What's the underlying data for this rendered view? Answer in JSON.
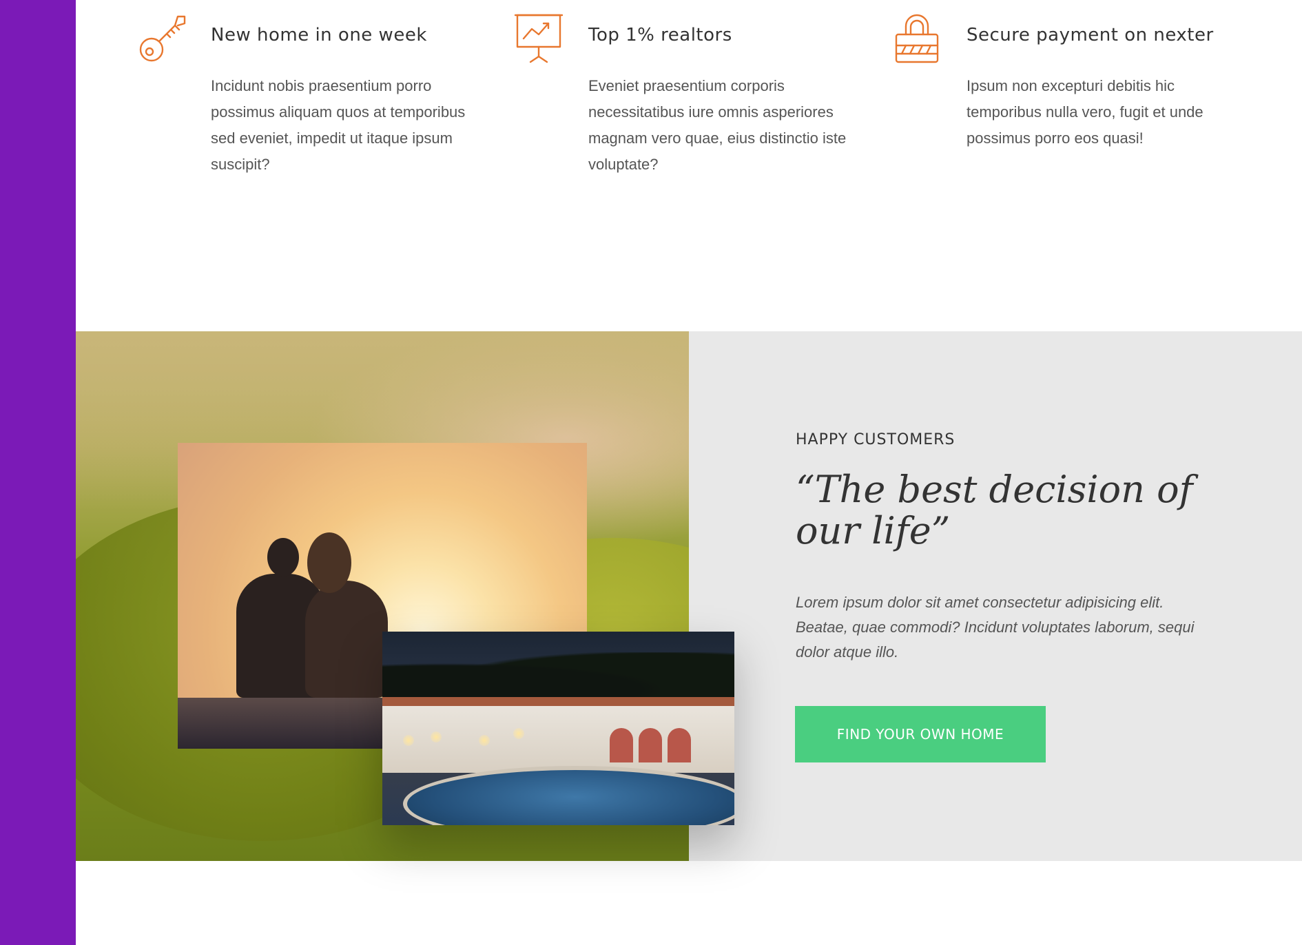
{
  "colors": {
    "sidebar": "#7b1ab7",
    "accent_icon": "#e8772e",
    "cta": "#4ace80",
    "story_panel": "#e8e8e8"
  },
  "features": [
    {
      "icon": "key-icon",
      "title": "New home in one week",
      "text": "Incidunt nobis praesentium porro possimus aliquam quos at temporibus sed eveniet, impedit ut itaque ipsum suscipit?"
    },
    {
      "icon": "presentation-chart-icon",
      "title": "Top 1% realtors",
      "text": "Eveniet praesentium corporis necessitatibus iure omnis asperiores magnam vero quae, eius distinctio iste voluptate?"
    },
    {
      "icon": "padlock-icon",
      "title": "Secure payment on nexter",
      "text": "Ipsum non excepturi debitis hic temporibus nulla vero, fugit et unde possimus porro eos quasi!"
    }
  ],
  "story": {
    "eyebrow": "Happy Customers",
    "quote": "“The best decision of our life”",
    "body": "Lorem ipsum dolor sit amet consectetur adipisicing elit. Beatae, quae commodi? Incidunt voluptates laborum, sequi dolor atque illo.",
    "cta_label": "Find your own home"
  }
}
